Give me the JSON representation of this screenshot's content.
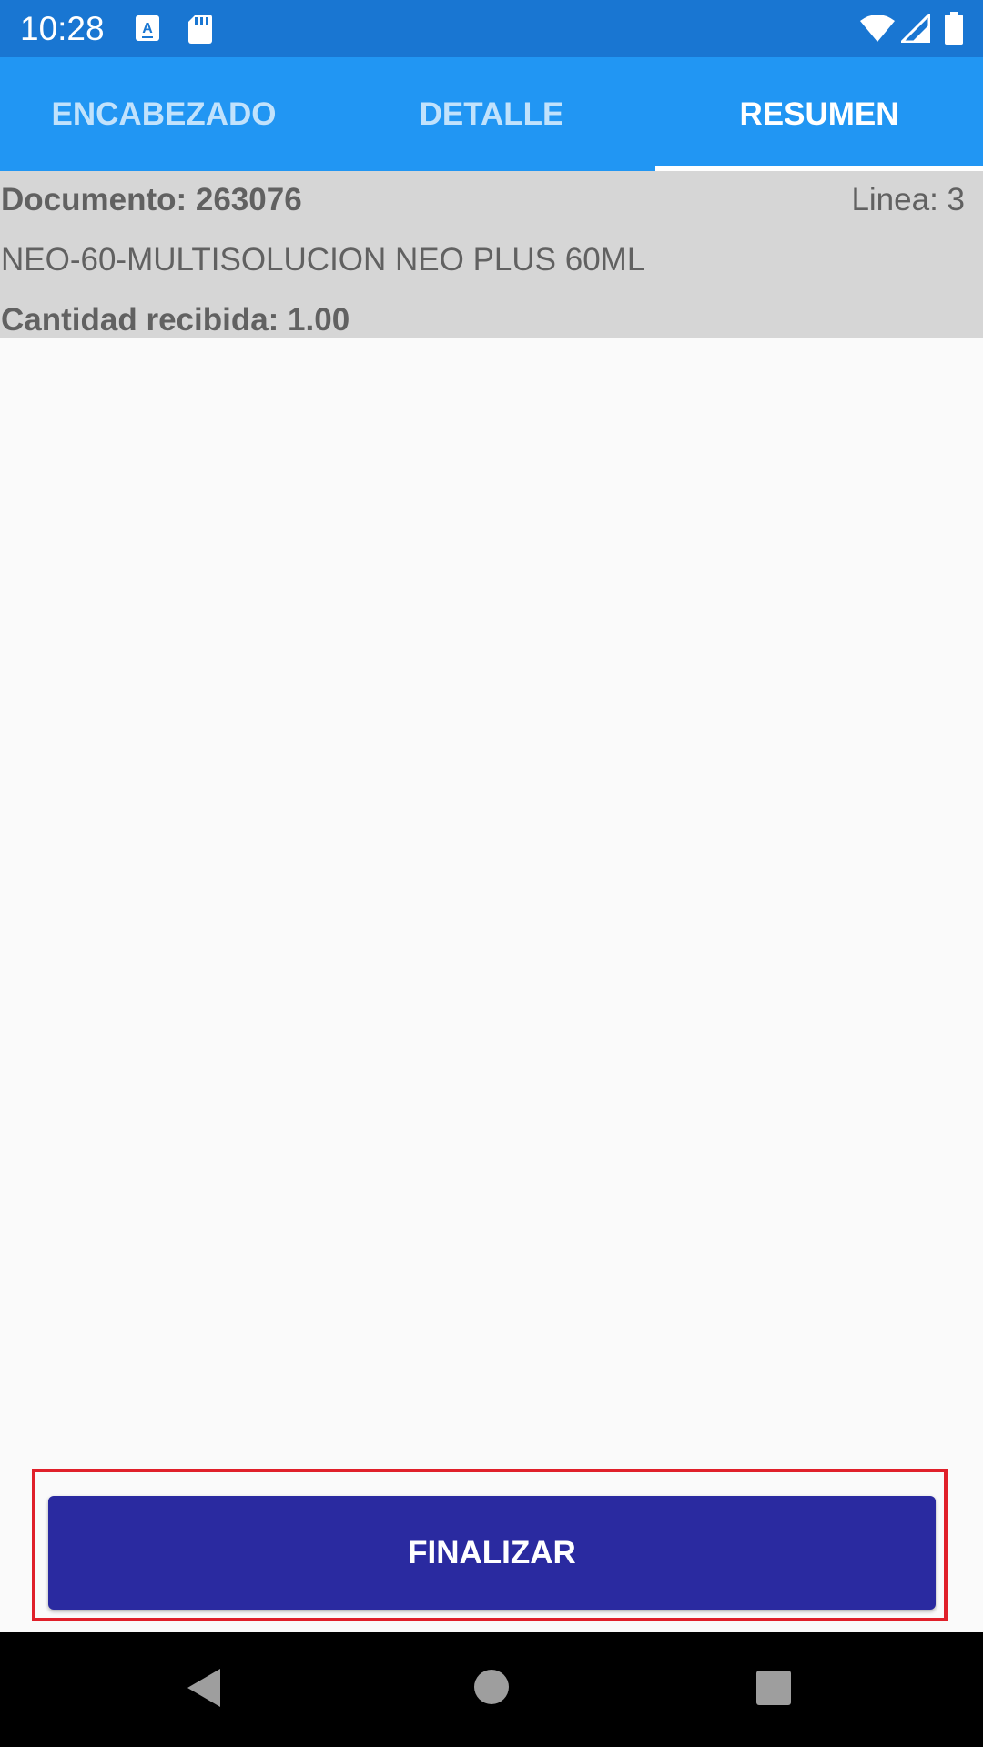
{
  "status_bar": {
    "time": "10:28",
    "icons": [
      "keyboard-a-icon",
      "sd-card-icon",
      "wifi-icon",
      "signal-icon",
      "battery-icon"
    ],
    "color": "#1976d2"
  },
  "tabs": [
    {
      "label": "ENCABEZADO",
      "active": false
    },
    {
      "label": "DETALLE",
      "active": false
    },
    {
      "label": "RESUMEN",
      "active": true
    }
  ],
  "summary": {
    "document": "Documento: 263076",
    "linea": "Linea: 3",
    "product": "NEO-60-MULTISOLUCION NEO PLUS 60ML",
    "quantity": "Cantidad recibida: 1.00"
  },
  "actions": {
    "finalize_label": "FINALIZAR"
  },
  "colors": {
    "accent": "#2196f3",
    "button": "#2a2aa0",
    "highlight": "#e0202a"
  },
  "nav_bar": {
    "icons": [
      "back-icon",
      "home-icon",
      "recents-icon"
    ]
  }
}
